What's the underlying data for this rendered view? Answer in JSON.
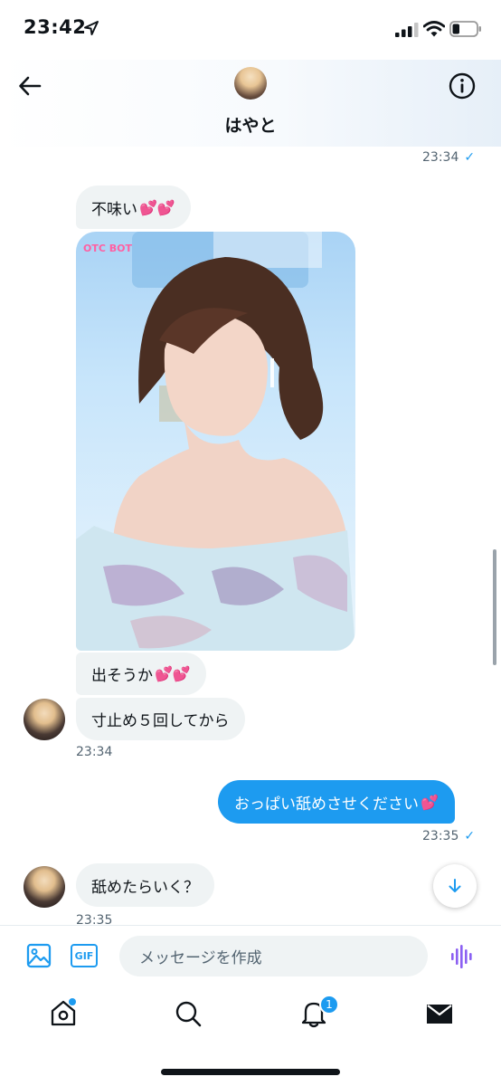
{
  "status_bar": {
    "time": "23:42"
  },
  "header": {
    "contact_name": "はやと"
  },
  "messages": {
    "sent_1": {
      "time": "23:34",
      "status": "✓"
    },
    "recv_1": {
      "text": "不味い",
      "emoji": "💕💕"
    },
    "photo": {
      "watermark": "OTC BOT",
      "alt": ""
    },
    "recv_2": {
      "text": "出そうか",
      "emoji": "💕💕"
    },
    "recv_3": {
      "text": "寸止め５回してから",
      "time": "23:34"
    },
    "sent_2": {
      "text": "おっぱい舐めさせください",
      "emoji": "💕",
      "time": "23:35",
      "status": "✓"
    },
    "recv_4": {
      "text": "舐めたらいく？",
      "time": "23:35"
    }
  },
  "composer": {
    "gif_label": "GIF",
    "placeholder": "メッセージを作成"
  },
  "tabbar": {
    "notification_count": "1"
  },
  "colors": {
    "accent": "#1d9bf0",
    "incoming_bubble": "#eff3f4"
  }
}
